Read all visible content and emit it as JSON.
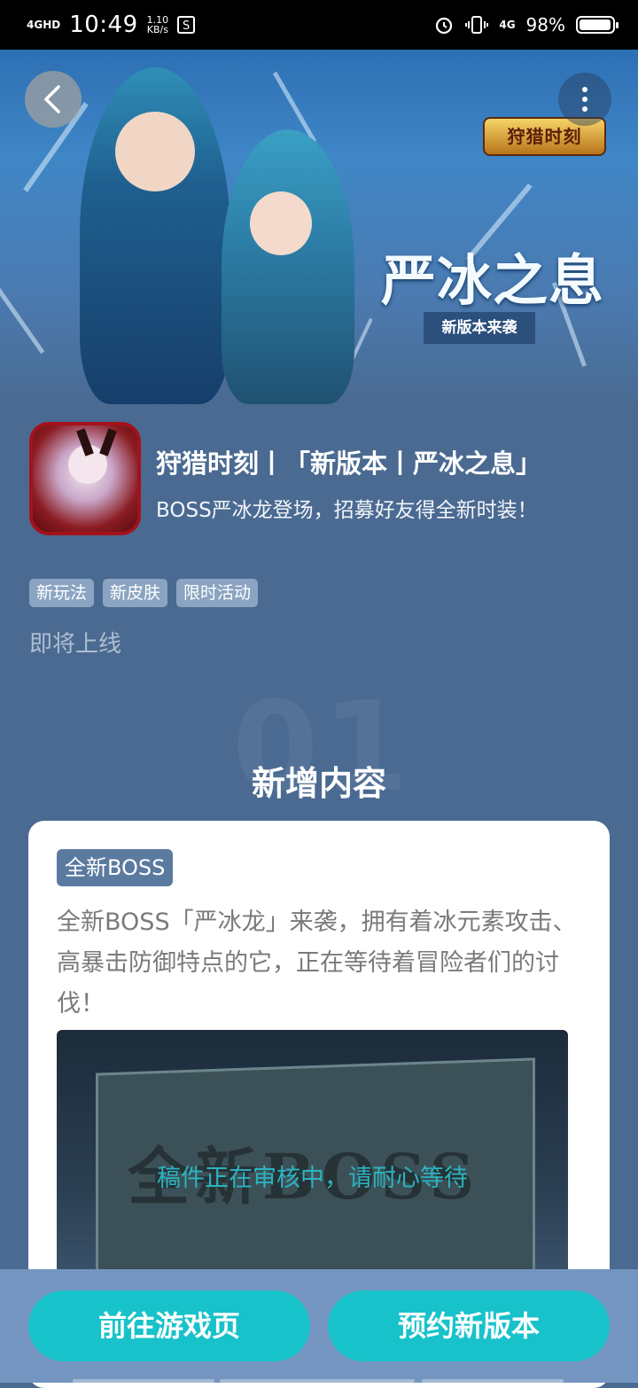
{
  "status_bar": {
    "network": "4GHD",
    "time": "10:49",
    "speed_value": "1.10",
    "speed_unit": "KB/s",
    "box_glyph": "S",
    "network_right": "4G",
    "battery_percent": "98%",
    "battery_level": 0.98
  },
  "hero": {
    "logo_text": "狩猎时刻",
    "title": "严冰之息",
    "subtitle": "新版本来袭"
  },
  "app": {
    "title": "狩猎时刻丨「新版本丨严冰之息」",
    "description": "BOSS严冰龙登场，招募好友得全新时装！",
    "tags": [
      "新玩法",
      "新皮肤",
      "限时活动"
    ],
    "status": "即将上线"
  },
  "section": {
    "number": "01",
    "title": "新增内容"
  },
  "card": {
    "tag": "全新BOSS",
    "text": "全新BOSS「严冰龙」来袭，拥有着冰元素攻击、高暴击防御特点的它，正在等待着冒险者们的讨伐！",
    "image_text": "全新BOSS",
    "review_text": "稿件正在审核中，请耐心等待"
  },
  "actions": {
    "go_game_page": "前往游戏页",
    "reserve": "预约新版本"
  },
  "colors": {
    "page_bg": "#4a6a91",
    "accent_button": "#18c2ca",
    "tag_bg": "#8aa4c1",
    "card_tag_bg": "#5b7aa0"
  }
}
